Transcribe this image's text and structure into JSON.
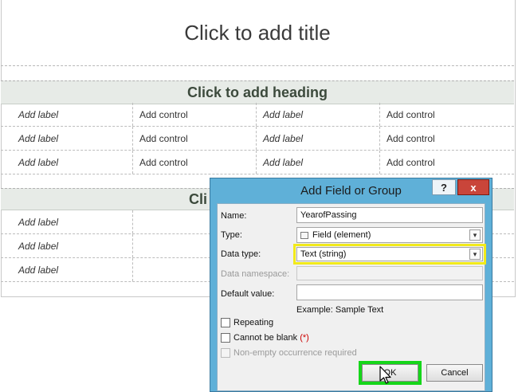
{
  "form": {
    "title": "Click to add title",
    "section1": {
      "heading": "Click to add heading",
      "rows": [
        [
          "Add label",
          "Add control",
          "Add label",
          "Add control"
        ],
        [
          "Add label",
          "Add control",
          "Add label",
          "Add control"
        ],
        [
          "Add label",
          "Add control",
          "Add label",
          "Add control"
        ]
      ]
    },
    "section2": {
      "heading_visible": "Cli",
      "rows": [
        [
          "Add label"
        ],
        [
          "Add label"
        ],
        [
          "Add label"
        ]
      ]
    }
  },
  "dialog": {
    "title": "Add Field or Group",
    "help_label": "?",
    "close_label": "x",
    "name_label": "Name:",
    "name_value": "YearofPassing",
    "type_label": "Type:",
    "type_value": "Field (element)",
    "datatype_label": "Data type:",
    "datatype_value": "Text (string)",
    "namespace_label": "Data namespace:",
    "namespace_value": "",
    "default_label": "Default value:",
    "default_value": "",
    "example_text": "Example: Sample Text",
    "repeating_label": "Repeating",
    "cannot_blank_label": "Cannot be blank",
    "cannot_blank_mark": "(*)",
    "nonempty_label": "Non-empty occurrence required",
    "ok_label": "OK",
    "cancel_label": "Cancel"
  },
  "colors": {
    "dialog_frame": "#5fb0d8",
    "highlight_datatype": "#f2ea1a",
    "highlight_ok": "#16d61a",
    "required_mark": "#cc0000",
    "heading_band": "#e7ebe7"
  },
  "icons": {
    "dropdown": "chevron-down-icon",
    "field_type": "field-element-icon",
    "cursor": "mouse-pointer-icon"
  }
}
